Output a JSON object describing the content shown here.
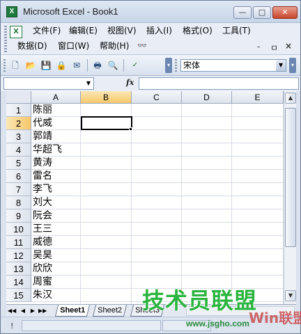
{
  "window": {
    "title": "Microsoft Excel - Book1",
    "app_icon_glyph": "X"
  },
  "window_controls": {
    "minimize": "—",
    "restore": "□",
    "close": "✕"
  },
  "menu": {
    "doc_icon_glyph": "X",
    "row1": [
      "文件(F)",
      "编辑(E)",
      "视图(V)",
      "插入(I)",
      "格式(O)",
      "工具(T)"
    ],
    "row2": [
      "数据(D)",
      "窗口(W)",
      "帮助(H)"
    ],
    "doc_controls": {
      "minimize": "-",
      "restore": "ㅁ",
      "close": "×"
    }
  },
  "toolbar": {
    "icons": [
      "new-icon",
      "open-icon",
      "save-icon",
      "permission-icon",
      "email-icon",
      "print-icon",
      "print-preview-icon",
      "spelling-icon"
    ],
    "font_name": "宋体"
  },
  "formula_bar": {
    "name_box": "",
    "fx_label": "fx",
    "value": ""
  },
  "grid": {
    "columns": [
      "A",
      "B",
      "C",
      "D",
      "E"
    ],
    "active_column": "B",
    "active_row": 2,
    "rows": [
      {
        "num": "1",
        "A": "陈丽"
      },
      {
        "num": "2",
        "A": "代威"
      },
      {
        "num": "3",
        "A": "郭靖"
      },
      {
        "num": "4",
        "A": "华超飞"
      },
      {
        "num": "5",
        "A": "黄涛"
      },
      {
        "num": "6",
        "A": "雷名"
      },
      {
        "num": "7",
        "A": "李飞"
      },
      {
        "num": "8",
        "A": "刘大"
      },
      {
        "num": "9",
        "A": "阮会"
      },
      {
        "num": "10",
        "A": "王三"
      },
      {
        "num": "11",
        "A": "威德"
      },
      {
        "num": "12",
        "A": "吴昊"
      },
      {
        "num": "13",
        "A": "欣欣"
      },
      {
        "num": "14",
        "A": "周蜜"
      },
      {
        "num": "15",
        "A": "朱汉"
      }
    ]
  },
  "sheet_tabs": {
    "nav": [
      "◀◀",
      "◀",
      "▶",
      "▶▶"
    ],
    "tabs": [
      "Sheet1",
      "Sheet2",
      "Sheet3"
    ],
    "active": "Sheet1"
  },
  "status_bar": {
    "grip": "!"
  },
  "watermark": {
    "brand": "技术员联盟",
    "url": "www.jsgho.com",
    "logo": "Win联盟"
  },
  "colors": {
    "active_header": "#f7c86a",
    "watermark_green": "#2bb43f",
    "close_red": "#c8432a"
  }
}
